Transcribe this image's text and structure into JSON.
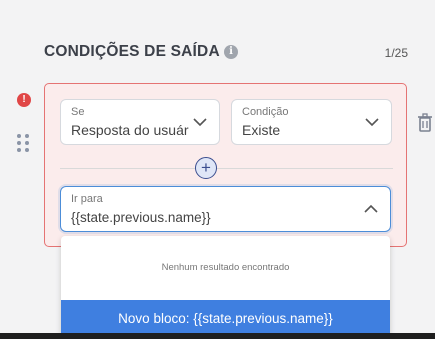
{
  "section": {
    "title": "CONDIÇÕES DE SAÍDA",
    "info_glyph": "i",
    "counter": "1/25"
  },
  "condition": {
    "alert_glyph": "!",
    "se": {
      "label": "Se",
      "value": "Resposta do usuári"
    },
    "condicao": {
      "label": "Condição",
      "value": "Existe"
    },
    "add_glyph": "+",
    "ir_para": {
      "label": "Ir para",
      "value": "{{state.previous.name}}"
    }
  },
  "dropdown": {
    "empty_message": "Nenhum resultado encontrado",
    "new_block_label": "Novo bloco: {{state.previous.name}}"
  },
  "colors": {
    "accent": "#3f7fe0",
    "error_border": "#e57373",
    "card_bg": "#fbecec"
  },
  "icons": [
    "info-icon",
    "alert-icon",
    "drag-handle-icon",
    "trash-icon",
    "chevron-down-icon",
    "chevron-up-icon",
    "plus-icon"
  ]
}
